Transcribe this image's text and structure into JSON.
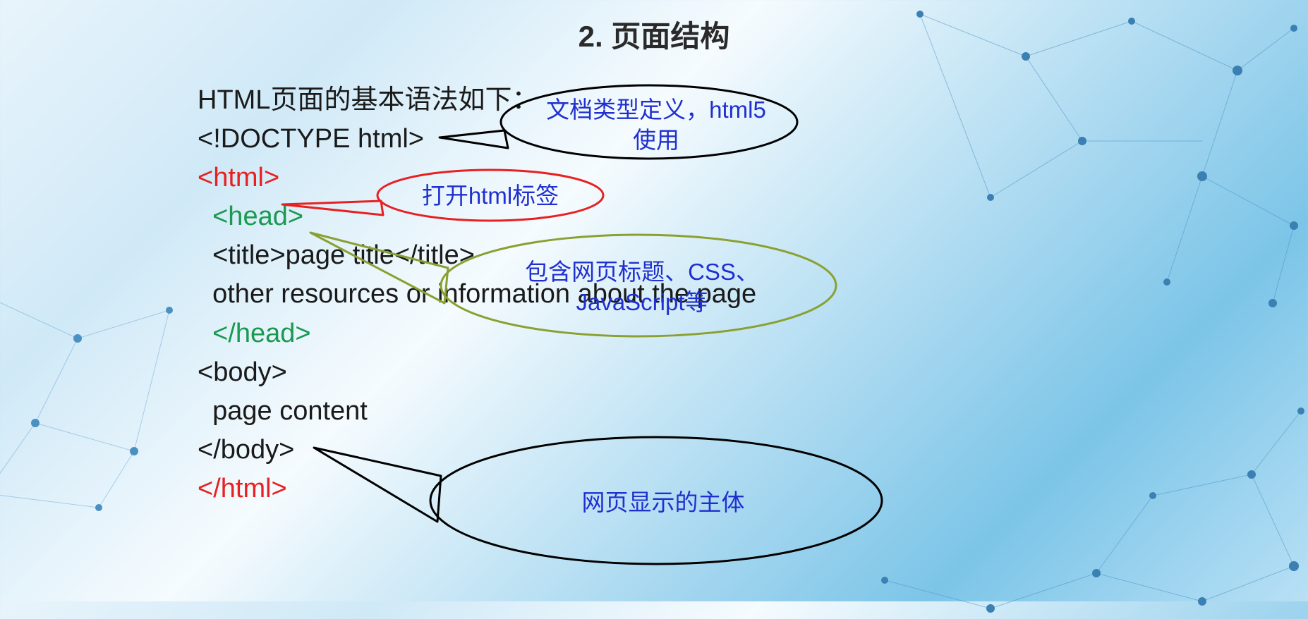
{
  "title": "2. 页面结构",
  "intro": "HTML页面的基本语法如下：",
  "code": {
    "doctype": "<!DOCTYPE html>",
    "html_open": "<html>",
    "head_open": "  <head>",
    "title_line": "  <title>page title</title>",
    "other_line": "  other resources or information about the page",
    "head_close": "  </head>",
    "body_open": "<body>",
    "page_content": "  page content",
    "body_close": "</body>",
    "html_close": "</html>"
  },
  "callouts": {
    "doctype": {
      "line1": "文档类型定义，html5",
      "line2": "使用"
    },
    "html_open": "打开html标签",
    "head": {
      "line1": "包含网页标题、CSS、",
      "line2": "JavaScript等"
    },
    "body": "网页显示的主体"
  }
}
